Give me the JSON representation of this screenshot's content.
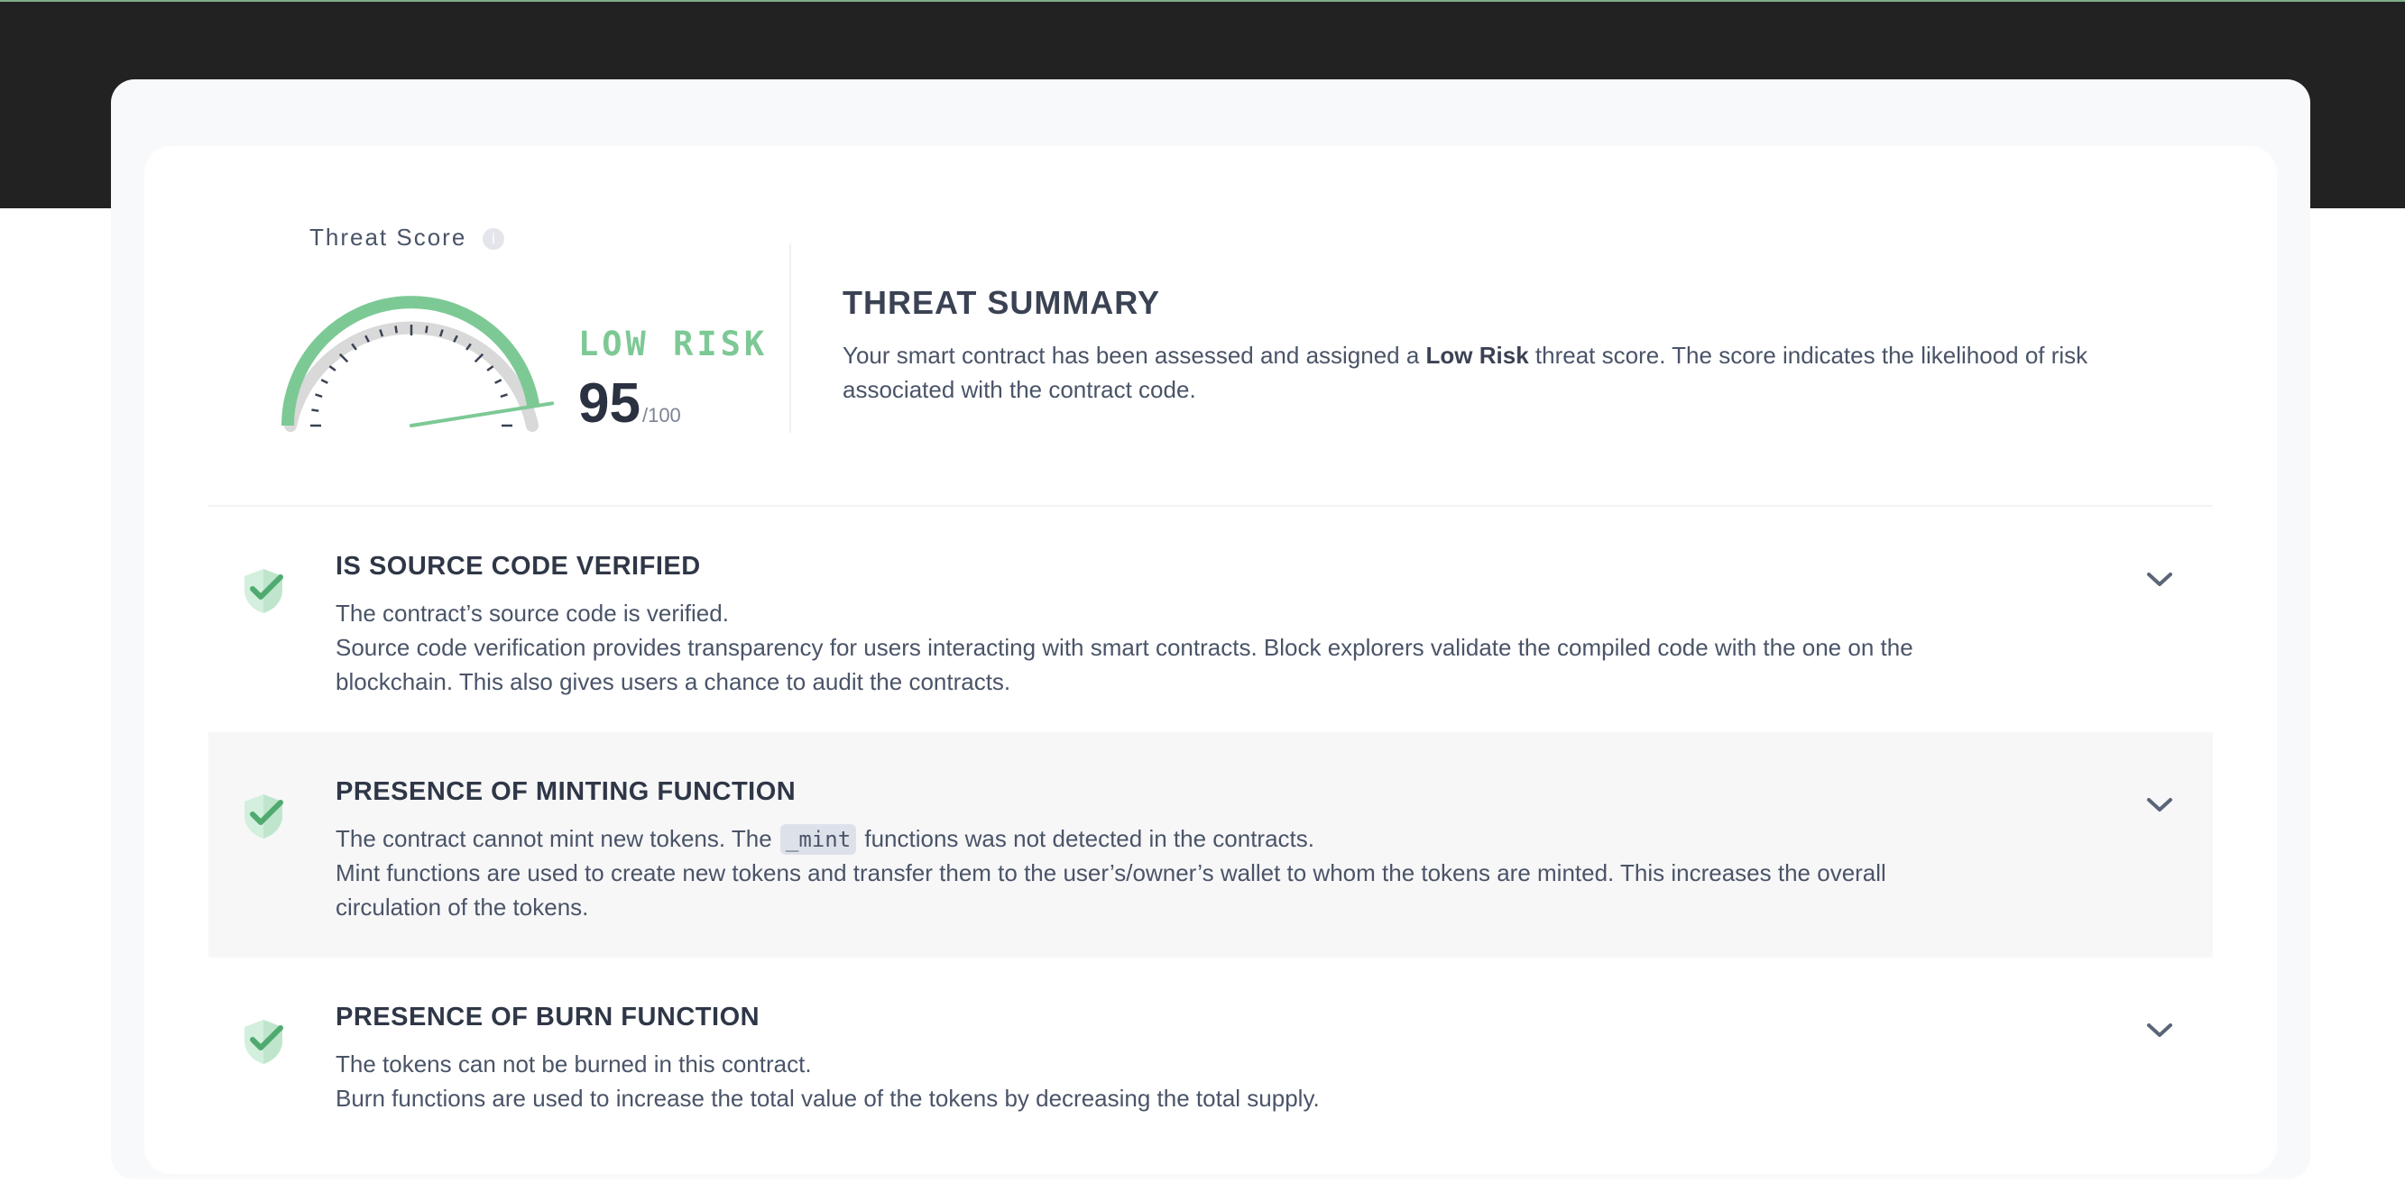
{
  "threat_score": {
    "label": "Threat Score",
    "info_icon": "info-icon",
    "risk_level": "LOW RISK",
    "score": "95",
    "max": "/100",
    "level_fraction": 0.95,
    "colors": {
      "accent": "#7dc995",
      "track": "#d9d9d9"
    }
  },
  "summary": {
    "title": "THREAT SUMMARY",
    "text_before": "Your smart contract has been assessed and assigned a ",
    "emphasis": "Low Risk",
    "text_after": " threat score. The score indicates the likelihood of risk associated with the contract code."
  },
  "checks": [
    {
      "icon": "shield-check-icon",
      "title": "IS SOURCE CODE VERIFIED",
      "status": "The contract’s source code is verified.",
      "description": "Source code verification provides transparency for users interacting with smart contracts. Block explorers validate the compiled code with the one on the blockchain. This also gives users a chance to audit the contracts."
    },
    {
      "icon": "shield-check-icon",
      "title": "PRESENCE OF MINTING FUNCTION",
      "status_before": "The contract cannot mint new tokens. The ",
      "code": "_mint",
      "status_after": " functions was not detected in the contracts.",
      "description": "Mint functions are used to create new tokens and transfer them to the user’s/owner’s wallet to whom the tokens are minted. This increases the overall circulation of the tokens."
    },
    {
      "icon": "shield-check-icon",
      "title": "PRESENCE OF BURN FUNCTION",
      "status": "The tokens can not be burned in this contract.",
      "description": "Burn functions are used to increase the total value of the tokens by decreasing the total supply."
    }
  ]
}
